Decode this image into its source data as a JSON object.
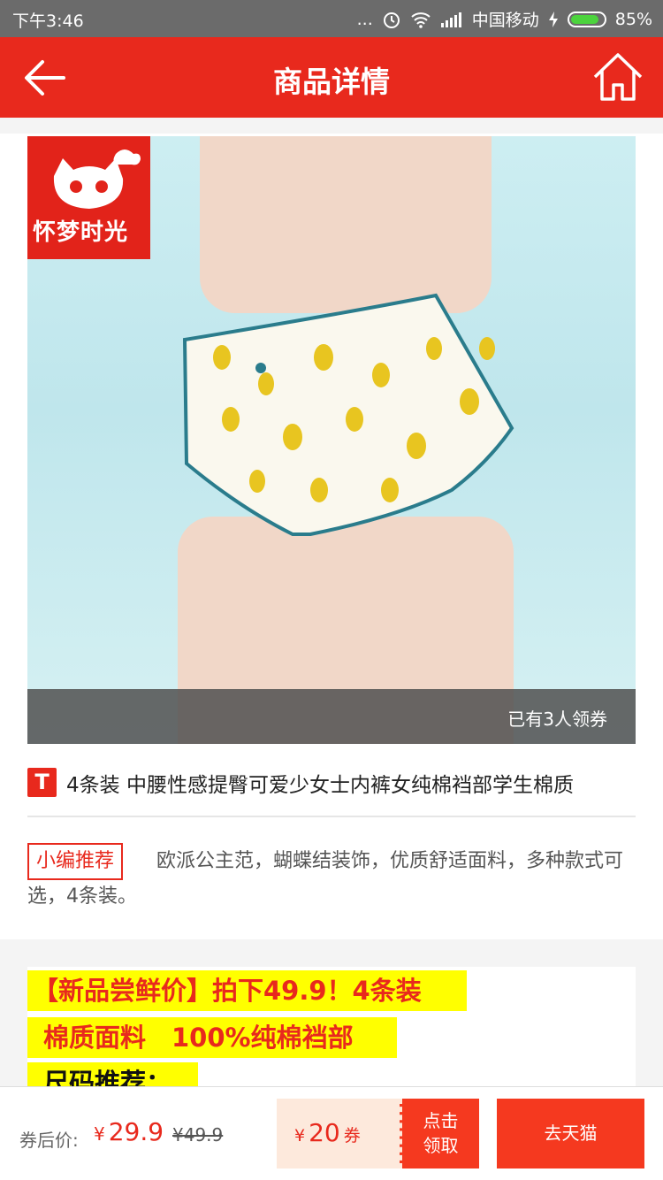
{
  "status_bar": {
    "time": "下午3:46",
    "dots": "...",
    "carrier": "中国移动",
    "battery": "85%",
    "battery_level": 0.85
  },
  "header": {
    "title": "商品详情",
    "back_icon": "arrow-left-icon",
    "home_icon": "home-icon"
  },
  "product": {
    "brand_logo_text": "怀梦时光",
    "coupon_count_text": "已有3人领券",
    "platform_badge": "T",
    "title": "4条装 中腰性感提臀可爱少女士内裤女纯棉裆部学生棉质"
  },
  "recommend": {
    "tag": "小编推荐",
    "text": "欧派公主范，蝴蝶结装饰，优质舒适面料，多种款式可选，4条装。"
  },
  "description": {
    "line1": "【新品尝鲜价】拍下49.9！4条装",
    "line2": "棉质面料　100%纯棉裆部",
    "line3": "尺码推荐："
  },
  "bottom_bar": {
    "after_coupon_label": "券后价:",
    "currency": "¥",
    "price": "29.9",
    "original_price": "¥49.9",
    "coupon_currency": "¥",
    "coupon_amount": "20",
    "coupon_unit": "券",
    "claim_line1": "点击",
    "claim_line2": "领取",
    "go_tmall": "去天猫"
  },
  "colors": {
    "accent": "#e8291d",
    "highlight": "#ffff00",
    "coupon_bg": "#fde9dc"
  }
}
